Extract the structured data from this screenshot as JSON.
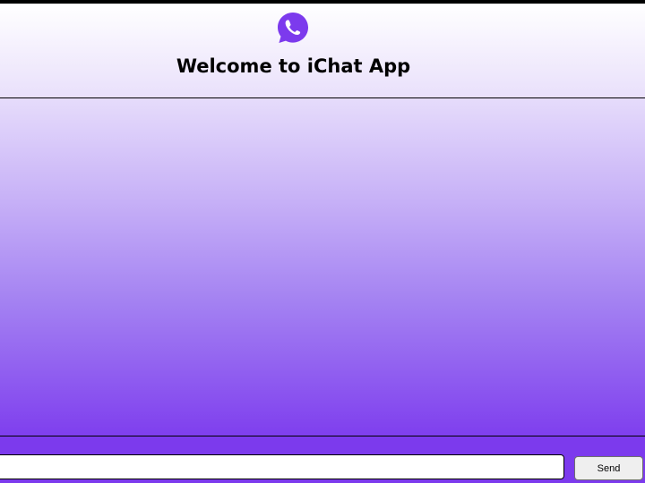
{
  "header": {
    "logo_icon": "whatsapp-phone-icon",
    "title": "Welcome to iChat App"
  },
  "composer": {
    "message_value": "",
    "send_label": "Send"
  },
  "colors": {
    "accent": "#7c3aed",
    "logo": "#7c3aed"
  }
}
